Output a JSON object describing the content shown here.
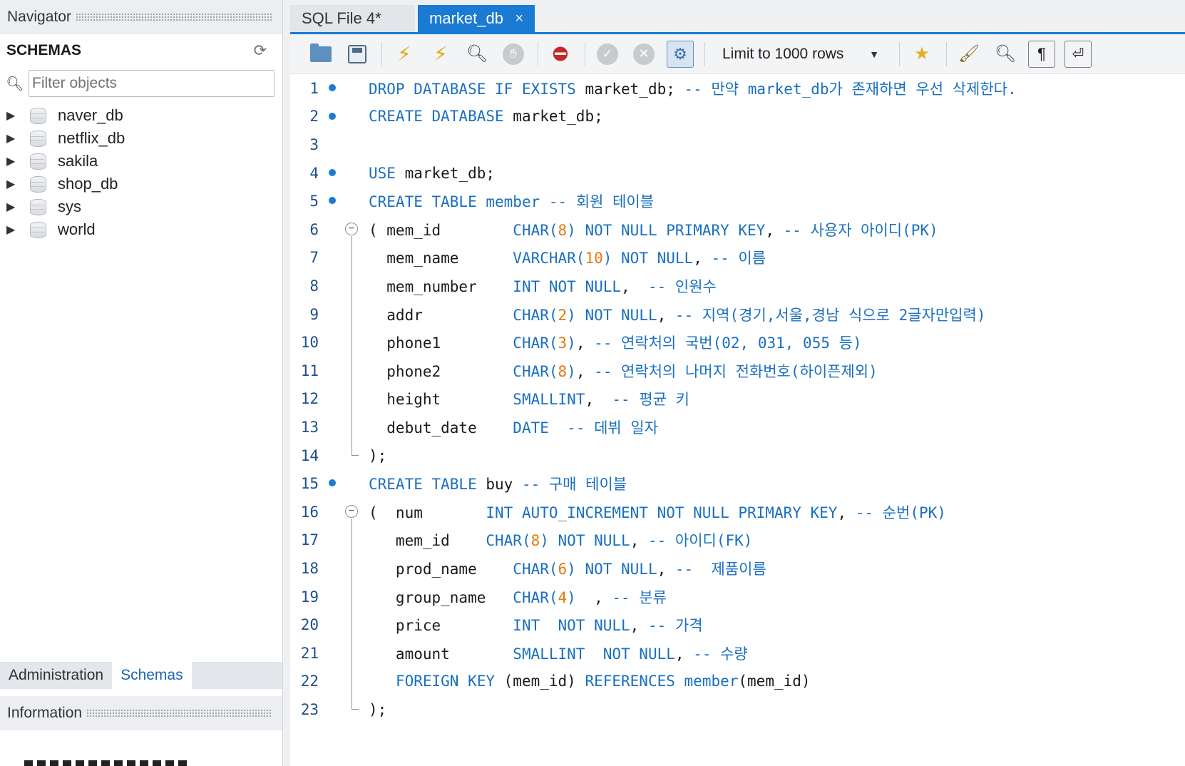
{
  "navigator": {
    "header": "Navigator",
    "schemas_title": "SCHEMAS",
    "filter_placeholder": "Filter objects",
    "schemas": [
      {
        "name": "naver_db"
      },
      {
        "name": "netflix_db"
      },
      {
        "name": "sakila"
      },
      {
        "name": "shop_db"
      },
      {
        "name": "sys"
      },
      {
        "name": "world"
      }
    ],
    "tabs": {
      "administration": "Administration",
      "schemas": "Schemas"
    },
    "info_header": "Information"
  },
  "editor": {
    "tabs": [
      {
        "label": "SQL File 4*"
      },
      {
        "label": "market_db",
        "close": "×"
      }
    ],
    "toolbar": {
      "limit_label": "Limit to 1000 rows",
      "icons": [
        "open-folder-icon",
        "save-icon",
        "execute-icon",
        "execute-current-icon",
        "explain-icon",
        "stop-icon",
        "toggle-error-icon",
        "commit-icon",
        "rollback-icon",
        "autocommit-icon",
        "add-snippet-icon",
        "beautify-icon",
        "find-icon",
        "invisible-chars-icon",
        "wrap-icon"
      ]
    },
    "accent_color": "#1a7ad4",
    "code_lines": [
      {
        "n": "1",
        "dot": true,
        "fold": false
      },
      {
        "n": "2",
        "dot": true,
        "fold": false
      },
      {
        "n": "3",
        "dot": false,
        "fold": false
      },
      {
        "n": "4",
        "dot": true,
        "fold": false
      },
      {
        "n": "5",
        "dot": true,
        "fold": false
      },
      {
        "n": "6",
        "dot": false,
        "fold": true
      },
      {
        "n": "7",
        "dot": false,
        "fold": false
      },
      {
        "n": "8",
        "dot": false,
        "fold": false
      },
      {
        "n": "9",
        "dot": false,
        "fold": false
      },
      {
        "n": "10",
        "dot": false,
        "fold": false
      },
      {
        "n": "11",
        "dot": false,
        "fold": false
      },
      {
        "n": "12",
        "dot": false,
        "fold": false
      },
      {
        "n": "13",
        "dot": false,
        "fold": false
      },
      {
        "n": "14",
        "dot": false,
        "fold": false
      },
      {
        "n": "15",
        "dot": true,
        "fold": false
      },
      {
        "n": "16",
        "dot": false,
        "fold": true
      },
      {
        "n": "17",
        "dot": false,
        "fold": false
      },
      {
        "n": "18",
        "dot": false,
        "fold": false
      },
      {
        "n": "19",
        "dot": false,
        "fold": false
      },
      {
        "n": "20",
        "dot": false,
        "fold": false
      },
      {
        "n": "21",
        "dot": false,
        "fold": false
      },
      {
        "n": "22",
        "dot": false,
        "fold": false
      },
      {
        "n": "23",
        "dot": false,
        "fold": false
      }
    ],
    "code_tokens": [
      [
        [
          "kw",
          "DROP DATABASE IF EXISTS"
        ],
        [
          "t",
          " market_db; "
        ],
        [
          "cm",
          "-- 만약 market_db가 존재하면 우선 삭제한다."
        ]
      ],
      [
        [
          "kw",
          "CREATE DATABASE"
        ],
        [
          "t",
          " market_db;"
        ]
      ],
      [],
      [
        [
          "kw",
          "USE"
        ],
        [
          "t",
          " market_db;"
        ]
      ],
      [
        [
          "kw",
          "CREATE TABLE"
        ],
        [
          "t",
          " "
        ],
        [
          "kw",
          "member"
        ],
        [
          "t",
          " "
        ],
        [
          "cm",
          "-- 회원 테이블"
        ]
      ],
      [
        [
          "t",
          "( mem_id        "
        ],
        [
          "kw",
          "CHAR("
        ],
        [
          "num",
          "8"
        ],
        [
          "kw",
          ") NOT NULL PRIMARY KEY"
        ],
        [
          "t",
          ", "
        ],
        [
          "cm",
          "-- 사용자 아이디(PK)"
        ]
      ],
      [
        [
          "t",
          "  mem_name      "
        ],
        [
          "kw",
          "VARCHAR("
        ],
        [
          "num",
          "10"
        ],
        [
          "kw",
          ") NOT NULL"
        ],
        [
          "t",
          ", "
        ],
        [
          "cm",
          "-- 이름"
        ]
      ],
      [
        [
          "t",
          "  mem_number    "
        ],
        [
          "kw",
          "INT NOT NULL"
        ],
        [
          "t",
          ",  "
        ],
        [
          "cm",
          "-- 인원수"
        ]
      ],
      [
        [
          "t",
          "  addr          "
        ],
        [
          "kw",
          "CHAR("
        ],
        [
          "num",
          "2"
        ],
        [
          "kw",
          ") NOT NULL"
        ],
        [
          "t",
          ", "
        ],
        [
          "cm",
          "-- 지역(경기,서울,경남 식으로 2글자만입력)"
        ]
      ],
      [
        [
          "t",
          "  phone1        "
        ],
        [
          "kw",
          "CHAR("
        ],
        [
          "num",
          "3"
        ],
        [
          "kw",
          ")"
        ],
        [
          "t",
          ", "
        ],
        [
          "cm",
          "-- 연락처의 국번(02, 031, 055 등)"
        ]
      ],
      [
        [
          "t",
          "  phone2        "
        ],
        [
          "kw",
          "CHAR("
        ],
        [
          "num",
          "8"
        ],
        [
          "kw",
          ")"
        ],
        [
          "t",
          ", "
        ],
        [
          "cm",
          "-- 연락처의 나머지 전화번호(하이픈제외)"
        ]
      ],
      [
        [
          "t",
          "  height        "
        ],
        [
          "kw",
          "SMALLINT"
        ],
        [
          "t",
          ",  "
        ],
        [
          "cm",
          "-- 평균 키"
        ]
      ],
      [
        [
          "t",
          "  debut_date    "
        ],
        [
          "kw",
          "DATE"
        ],
        [
          "t",
          "  "
        ],
        [
          "cm",
          "-- 데뷔 일자"
        ]
      ],
      [
        [
          "t",
          ");"
        ]
      ],
      [
        [
          "kw",
          "CREATE TABLE"
        ],
        [
          "t",
          " buy "
        ],
        [
          "cm",
          "-- 구매 테이블"
        ]
      ],
      [
        [
          "t",
          "(  num       "
        ],
        [
          "kw",
          "INT AUTO_INCREMENT NOT NULL PRIMARY KEY"
        ],
        [
          "t",
          ", "
        ],
        [
          "cm",
          "-- 순번(PK)"
        ]
      ],
      [
        [
          "t",
          "   mem_id    "
        ],
        [
          "kw",
          "CHAR("
        ],
        [
          "num",
          "8"
        ],
        [
          "kw",
          ") NOT NULL"
        ],
        [
          "t",
          ", "
        ],
        [
          "cm",
          "-- 아이디(FK)"
        ]
      ],
      [
        [
          "t",
          "   prod_name    "
        ],
        [
          "kw",
          "CHAR("
        ],
        [
          "num",
          "6"
        ],
        [
          "kw",
          ") NOT NULL"
        ],
        [
          "t",
          ", "
        ],
        [
          "cm",
          "--  제품이름"
        ]
      ],
      [
        [
          "t",
          "   group_name   "
        ],
        [
          "kw",
          "CHAR("
        ],
        [
          "num",
          "4"
        ],
        [
          "kw",
          ")"
        ],
        [
          "t",
          "  , "
        ],
        [
          "cm",
          "-- 분류"
        ]
      ],
      [
        [
          "t",
          "   price        "
        ],
        [
          "kw",
          "INT  NOT NULL"
        ],
        [
          "t",
          ", "
        ],
        [
          "cm",
          "-- 가격"
        ]
      ],
      [
        [
          "t",
          "   amount       "
        ],
        [
          "kw",
          "SMALLINT  NOT NULL"
        ],
        [
          "t",
          ", "
        ],
        [
          "cm",
          "-- 수량"
        ]
      ],
      [
        [
          "t",
          "   "
        ],
        [
          "kw",
          "FOREIGN KEY"
        ],
        [
          "t",
          " (mem_id) "
        ],
        [
          "kw",
          "REFERENCES member"
        ],
        [
          "t",
          "(mem_id)"
        ]
      ],
      [
        [
          "t",
          ");"
        ]
      ]
    ]
  }
}
